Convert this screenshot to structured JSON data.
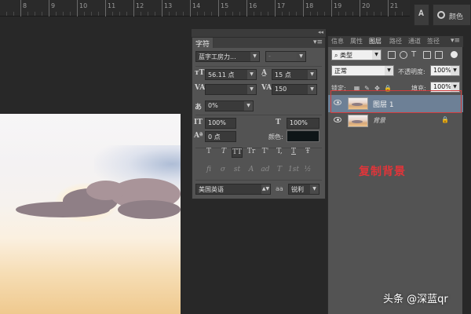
{
  "ruler": {
    "labels": [
      "8",
      "9",
      "10",
      "11",
      "12",
      "13",
      "14",
      "15",
      "16",
      "17",
      "18",
      "19",
      "20",
      "21"
    ]
  },
  "character_panel": {
    "tab_label": "字符",
    "font_family": "蓝字工房力...",
    "font_style": "-",
    "font_size": "56.11 点",
    "leading": "15 点",
    "kerning": "",
    "tracking": "150",
    "tsume": "0%",
    "vertical_scale": "100%",
    "horizontal_scale": "100%",
    "baseline_shift": "0 点",
    "color_label": "颜色:",
    "language": "美国英语",
    "antialias_label": "aa",
    "antialias": "锐利",
    "type_styles": [
      "T",
      "T",
      "TT",
      "Tr",
      "T'",
      "T,",
      "T",
      "Ŧ"
    ],
    "opentype_styles": [
      "fi",
      "σ",
      "st",
      "A",
      "ad",
      "T",
      "1st",
      "½"
    ]
  },
  "layers_panel": {
    "tabs": [
      "信息",
      "属性",
      "图层",
      "路径",
      "通道",
      "签径"
    ],
    "active_tab": "图层",
    "filter_kind": "类型",
    "blend_mode": "正常",
    "opacity_label": "不透明度:",
    "opacity_value": "100%",
    "lock_label": "锁定:",
    "fill_label": "填充:",
    "fill_value": "100%",
    "layers": [
      {
        "name": "图层 1",
        "selected": true
      },
      {
        "name": "背景",
        "selected": false,
        "locked": true
      }
    ]
  },
  "top_right": {
    "color_panel_label": "颜色"
  },
  "annotation": {
    "text": "复制背景",
    "color": "#e0353a"
  },
  "watermark": {
    "text": "头条 @深蓝qr"
  },
  "colors": {
    "panel_bg": "#535353",
    "selected_layer": "#6d8096",
    "highlight_box": "#d23b3b",
    "text_color_swatch": "#0e1517"
  }
}
